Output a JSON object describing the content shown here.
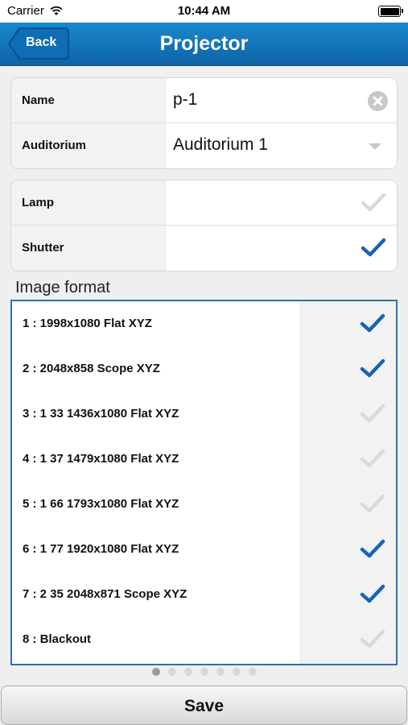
{
  "status_bar": {
    "carrier": "Carrier",
    "time": "10:44 AM"
  },
  "nav": {
    "back_label": "Back",
    "title": "Projector",
    "accent_color": "#1479c0"
  },
  "fields": {
    "name": {
      "label": "Name",
      "value": "p-1"
    },
    "auditorium": {
      "label": "Auditorium",
      "value": "Auditorium 1"
    }
  },
  "toggles": [
    {
      "label": "Lamp",
      "checked": false
    },
    {
      "label": "Shutter",
      "checked": true
    }
  ],
  "image_format": {
    "title": "Image format",
    "items": [
      {
        "label": "1 : 1998x1080 Flat XYZ",
        "checked": true
      },
      {
        "label": "2 : 2048x858 Scope XYZ",
        "checked": true
      },
      {
        "label": "3 : 1 33 1436x1080 Flat XYZ",
        "checked": false
      },
      {
        "label": "4 : 1 37 1479x1080 Flat XYZ",
        "checked": false
      },
      {
        "label": "5 : 1 66 1793x1080 Flat XYZ",
        "checked": false
      },
      {
        "label": "6 : 1 77 1920x1080 Flat XYZ",
        "checked": true
      },
      {
        "label": "7 : 2 35 2048x871 Scope XYZ",
        "checked": true
      },
      {
        "label": "8 : Blackout",
        "checked": false
      }
    ]
  },
  "pager": {
    "pages": 7,
    "current": 1
  },
  "save_label": "Save",
  "colors": {
    "check_on": "#1565b5",
    "check_off": "#d9d9d9"
  }
}
